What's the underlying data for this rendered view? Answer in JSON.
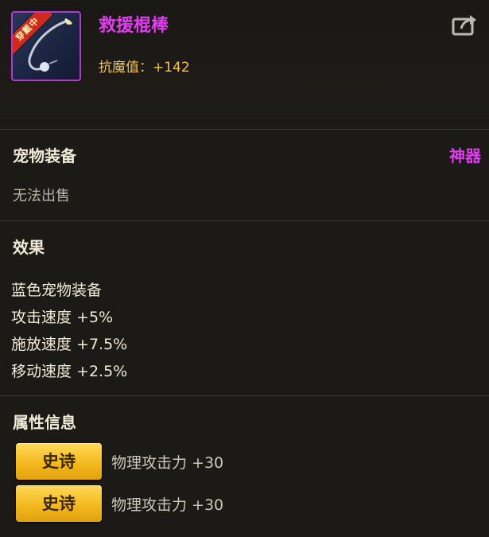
{
  "item": {
    "name": "救援棍棒",
    "equipped_badge": "穿戴中",
    "stat": "抗魔值：+142",
    "share_icon": "share-icon"
  },
  "category": {
    "title": "宠物装备",
    "grade": "神器",
    "sell_note": "无法出售"
  },
  "effects": {
    "title": "效果",
    "lines": [
      "蓝色宠物装备",
      "攻击速度 +5%",
      "施放速度 +7.5%",
      "移动速度 +2.5%"
    ]
  },
  "attributes": {
    "title": "属性信息",
    "rows": [
      {
        "badge": "史诗",
        "text": "物理攻击力 +30"
      },
      {
        "badge": "史诗",
        "text": "物理攻击力 +30"
      }
    ]
  },
  "colors": {
    "grade": "#e23cf0",
    "stat": "#f2c64a",
    "epic": "#f4b91e"
  }
}
